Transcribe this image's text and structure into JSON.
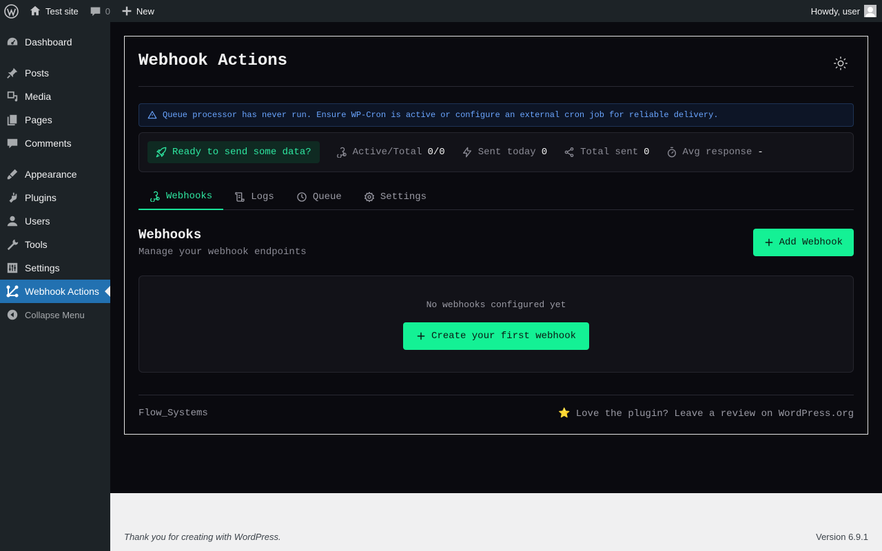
{
  "adminbar": {
    "site_name": "Test site",
    "comments_count": "0",
    "new_label": "New",
    "howdy": "Howdy, user"
  },
  "sidebar": {
    "items": [
      {
        "label": "Dashboard",
        "icon": "dashboard-icon"
      },
      {
        "label": "Posts",
        "icon": "pin-icon"
      },
      {
        "label": "Media",
        "icon": "media-icon"
      },
      {
        "label": "Pages",
        "icon": "pages-icon"
      },
      {
        "label": "Comments",
        "icon": "comment-icon"
      },
      {
        "label": "Appearance",
        "icon": "brush-icon"
      },
      {
        "label": "Plugins",
        "icon": "plug-icon"
      },
      {
        "label": "Users",
        "icon": "user-icon"
      },
      {
        "label": "Tools",
        "icon": "wrench-icon"
      },
      {
        "label": "Settings",
        "icon": "sliders-icon"
      },
      {
        "label": "Webhook Actions",
        "icon": "webhook-icon",
        "active": true
      }
    ],
    "collapse_label": "Collapse Menu"
  },
  "panel": {
    "title": "Webhook Actions",
    "notice": "Queue processor has never run. Ensure WP-Cron is active or configure an external cron job for reliable delivery.",
    "ready": "Ready to send some data?",
    "stats": {
      "active_label": "Active/Total",
      "active_value": "0/0",
      "sent_today_label": "Sent today",
      "sent_today_value": "0",
      "total_sent_label": "Total sent",
      "total_sent_value": "0",
      "avg_label": "Avg response",
      "avg_value": "-"
    },
    "tabs": [
      "Webhooks",
      "Logs",
      "Queue",
      "Settings"
    ],
    "section_title": "Webhooks",
    "section_subtitle": "Manage your webhook endpoints",
    "add_button": "Add Webhook",
    "empty_text": "No webhooks configured yet",
    "create_button": "Create your first webhook",
    "footer_left": "Flow_Systems",
    "footer_right": "Love the plugin? Leave a review on WordPress.org"
  },
  "wpfooter": {
    "thanks": "Thank you for creating with WordPress.",
    "version": "Version 6.9.1"
  },
  "colors": {
    "accent": "#14f195",
    "wp_blue": "#2271b1",
    "admin_dark": "#1d2327",
    "notice_text": "#6aa5ff"
  }
}
